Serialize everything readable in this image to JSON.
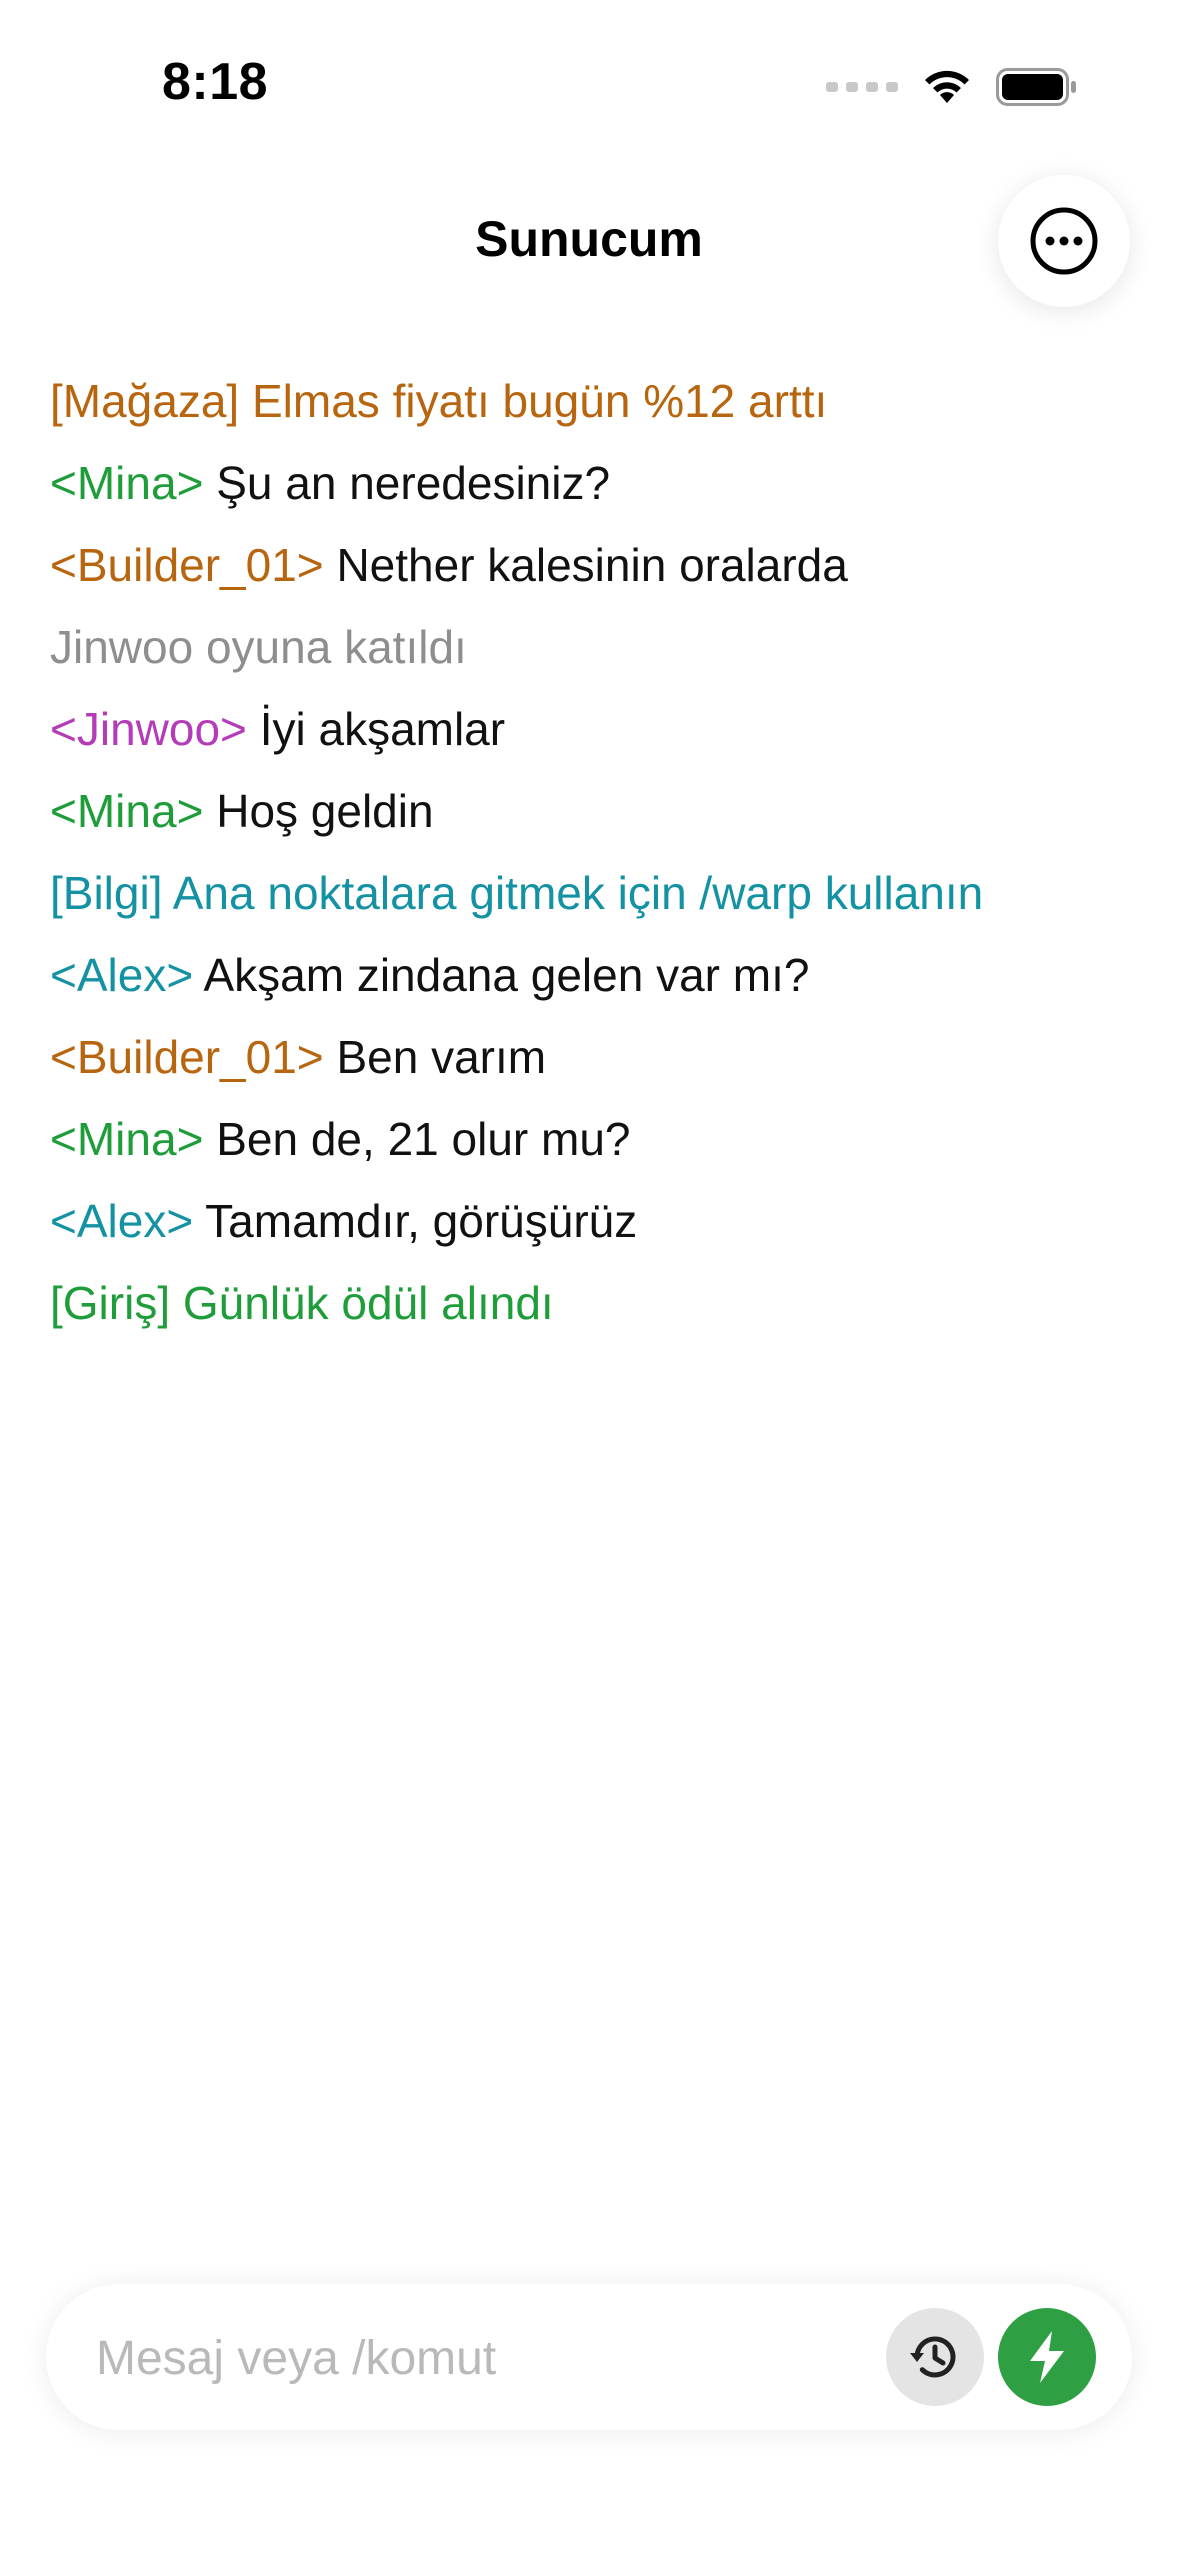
{
  "status_bar": {
    "time": "8:18"
  },
  "header": {
    "title": "Sunucum"
  },
  "colors": {
    "shop": "#b8650f",
    "mina": "#1f9d3a",
    "builder": "#b8650f",
    "system": "#8e8e8e",
    "jinwoo": "#b43cb9",
    "info": "#1492a3",
    "alex": "#1492a3",
    "login": "#1f9d3a",
    "send_button": "#2ea043"
  },
  "chat": {
    "lines": [
      {
        "sender": "[Mağaza] Elmas fiyatı bugün %12 arttı",
        "body": "",
        "color": "#b8650f"
      },
      {
        "sender": "<Mina>",
        "body": " Şu an neredesiniz?",
        "color": "#1f9d3a"
      },
      {
        "sender": "<Builder_01>",
        "body": " Nether kalesinin oralarda",
        "color": "#b8650f"
      },
      {
        "sender": "Jinwoo oyuna katıldı",
        "body": "",
        "color": "#8e8e8e"
      },
      {
        "sender": "<Jinwoo>",
        "body": " İyi akşamlar",
        "color": "#b43cb9"
      },
      {
        "sender": "<Mina>",
        "body": " Hoş geldin",
        "color": "#1f9d3a"
      },
      {
        "sender": "[Bilgi] Ana noktalara gitmek için /warp kullanın",
        "body": "",
        "color": "#1492a3"
      },
      {
        "sender": "<Alex>",
        "body": " Akşam zindana gelen var mı?",
        "color": "#1492a3"
      },
      {
        "sender": "<Builder_01>",
        "body": " Ben varım",
        "color": "#b8650f"
      },
      {
        "sender": "<Mina>",
        "body": " Ben de, 21 olur mu?",
        "color": "#1f9d3a"
      },
      {
        "sender": "<Alex>",
        "body": " Tamamdır, görüşürüz",
        "color": "#1492a3"
      },
      {
        "sender": "[Giriş] Günlük ödül alındı",
        "body": "",
        "color": "#1f9d3a"
      }
    ]
  },
  "composer": {
    "placeholder": "Mesaj veya /komut",
    "value": ""
  },
  "icons": {
    "more": "more-horizontal-circle-icon",
    "history": "history-clock-icon",
    "send": "lightning-bolt-icon",
    "wifi": "wifi-icon",
    "battery": "battery-icon",
    "signal": "cellular-signal-icon"
  }
}
